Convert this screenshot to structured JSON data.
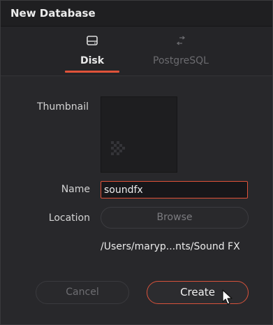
{
  "dialog": {
    "title": "New Database"
  },
  "tabs": [
    {
      "label": "Disk",
      "icon": "disk-icon",
      "selected": true
    },
    {
      "label": "PostgreSQL",
      "icon": "network-arrows-icon",
      "selected": false
    }
  ],
  "form": {
    "thumbnail_label": "Thumbnail",
    "name_label": "Name",
    "name_value": "soundfx",
    "location_label": "Location",
    "browse_label": "Browse",
    "location_path": "/Users/maryp...nts/Sound FX"
  },
  "buttons": {
    "cancel_label": "Cancel",
    "create_label": "Create"
  },
  "colors": {
    "accent": "#e0533a",
    "background": "#28282b",
    "titlebar": "#1f1f21"
  }
}
